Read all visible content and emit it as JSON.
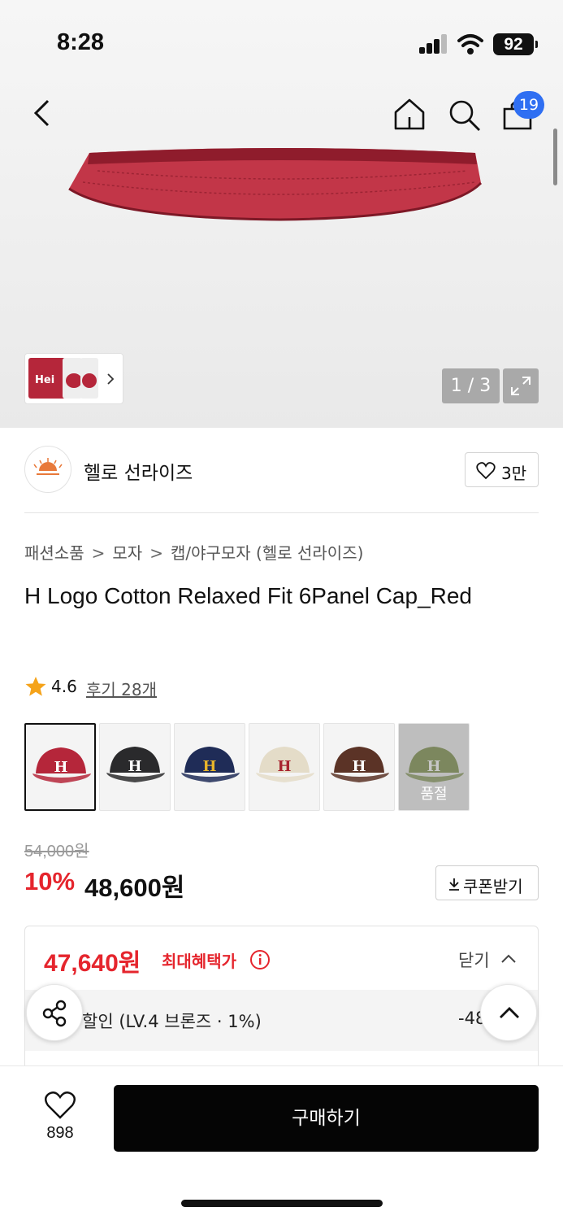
{
  "status_bar": {
    "time": "8:28",
    "battery": "92"
  },
  "nav": {
    "cart_badge": "19"
  },
  "gallery": {
    "page_counter": "1 / 3"
  },
  "brand": {
    "name": "헬로 선라이즈",
    "like_count": "3만"
  },
  "breadcrumb": [
    "패션소품",
    "모자",
    "캡/야구모자 (헬로 선라이즈)"
  ],
  "product": {
    "title": "H Logo Cotton Relaxed Fit 6Panel Cap_Red",
    "rating": "4.6",
    "reviews_link": "후기 28개"
  },
  "colors": [
    {
      "name": "red",
      "hex": "#b5263a",
      "letter": "#ffffff",
      "selected": true,
      "soldout": false
    },
    {
      "name": "black",
      "hex": "#2a2a2c",
      "letter": "#ffffff",
      "selected": false,
      "soldout": false
    },
    {
      "name": "navy",
      "hex": "#1f2c57",
      "letter": "#e8b52a",
      "selected": false,
      "soldout": false
    },
    {
      "name": "cream",
      "hex": "#e4dcc8",
      "letter": "#a8242f",
      "selected": false,
      "soldout": false
    },
    {
      "name": "brown",
      "hex": "#5b3326",
      "letter": "#ffffff",
      "selected": false,
      "soldout": false
    },
    {
      "name": "olive",
      "hex": "#9fae79",
      "letter": "#ffffff",
      "selected": false,
      "soldout": true
    }
  ],
  "soldout_label": "품절",
  "price": {
    "original": "54,000원",
    "discount_rate": "10%",
    "sale": "48,600원",
    "coupon_button": "쿠폰받기"
  },
  "benefit": {
    "best_price": "47,640원",
    "best_label": "최대혜택가",
    "toggle_label": "닫기",
    "row_label": "할인 (LV.4 브론즈 · 1%)",
    "row_amount": "-48"
  },
  "bottom": {
    "wish_count": "898",
    "buy_label": "구매하기"
  },
  "accent_colors": {
    "discount_red": "#e5252d",
    "badge_blue": "#2f6ff2",
    "buy_black": "#050505"
  }
}
